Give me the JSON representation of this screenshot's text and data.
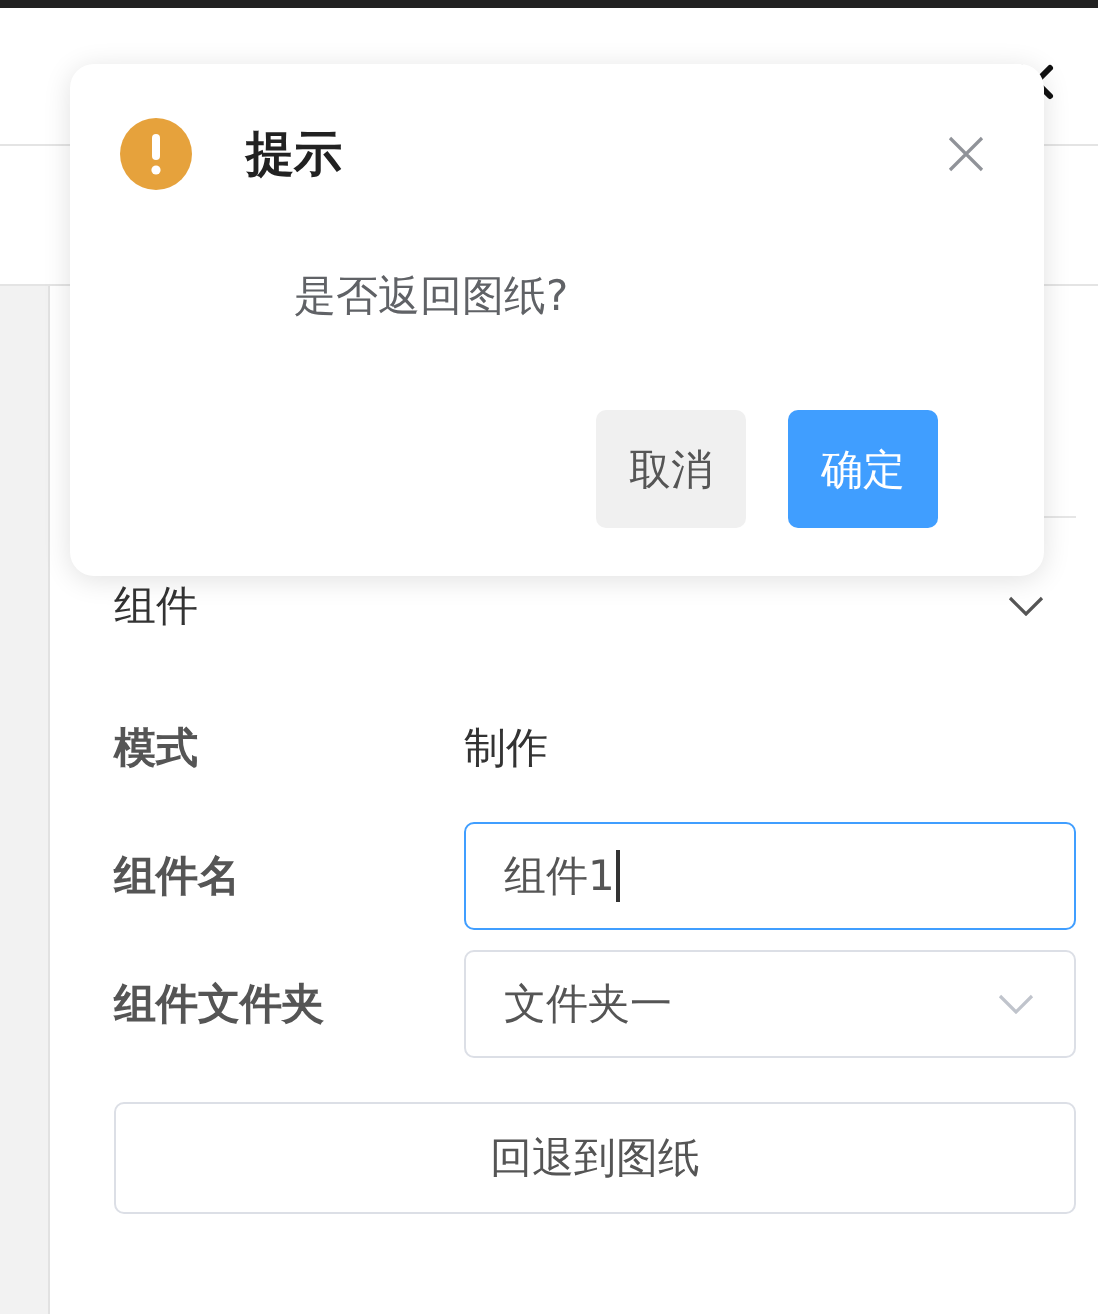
{
  "dialog": {
    "title": "提示",
    "message": "是否返回图纸?",
    "buttons": [
      {
        "label": "取消",
        "kind": "secondary"
      },
      {
        "label": "确定",
        "kind": "primary"
      }
    ]
  },
  "section": {
    "title": "组件",
    "expanded": true
  },
  "fields": [
    {
      "label": "模式",
      "kind": "text",
      "value": "制作"
    },
    {
      "label": "组件名",
      "kind": "input",
      "value": "组件1",
      "focused": true
    },
    {
      "label": "组件文件夹",
      "kind": "select",
      "value": "文件夹一"
    }
  ],
  "action_button": "回退到图纸"
}
